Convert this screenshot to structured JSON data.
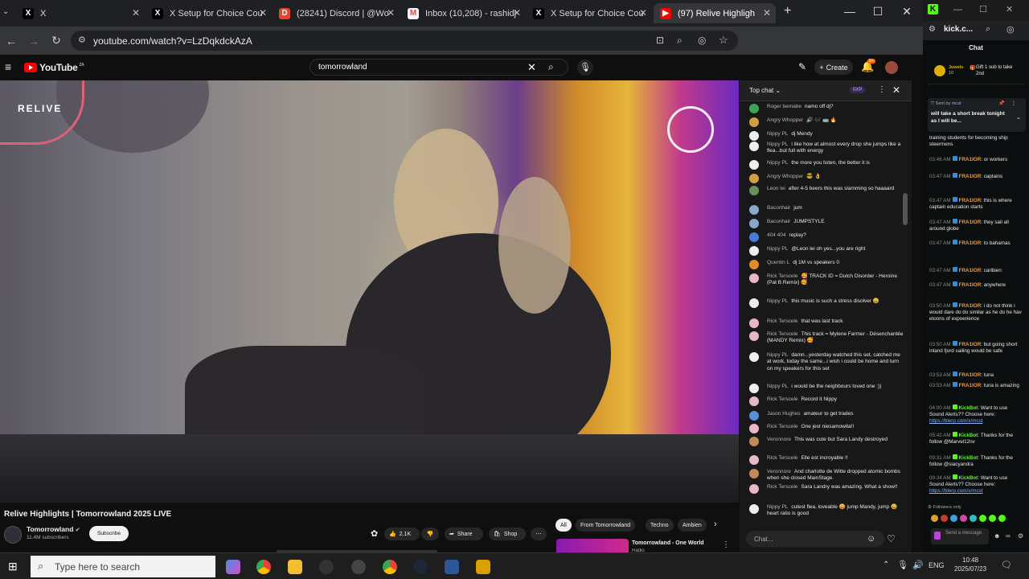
{
  "tabs": [
    {
      "title": "X",
      "icon": "X",
      "color": "#ffffff",
      "bg": "#000000"
    },
    {
      "title": "X Setup for Choice Cou",
      "icon": "X",
      "color": "#ffffff",
      "bg": "#000000"
    },
    {
      "title": "(28241) Discord | @Wo",
      "icon": "D",
      "color": "#ffffff",
      "bg": "#e8442b"
    },
    {
      "title": "Inbox (10,208) - rashidj",
      "icon": "M",
      "color": "#ea4335",
      "bg": "#ffffff"
    },
    {
      "title": "X Setup for Choice Cou",
      "icon": "X",
      "color": "#ffffff",
      "bg": "#000000"
    },
    {
      "title": "(97) Relive Highligh",
      "icon": "▶",
      "color": "#ffffff",
      "bg": "#ff0000"
    }
  ],
  "address": {
    "url": "youtube.com/watch?v=LzDqkdckAzA"
  },
  "youtube": {
    "logo": "YouTube",
    "country": "ZA",
    "search_value": "tomorrowland",
    "create_label": "Create",
    "notif_count": "9+"
  },
  "video": {
    "overlay_left": "RELIVE"
  },
  "info": {
    "title": "Relive Highlights | Tomorrowland 2025 LIVE",
    "channel": "Tomorrowland",
    "subscribers": "11.4M subscribers",
    "subscribe": "Subscribe",
    "likes": "2.1K",
    "share": "Share",
    "shop": "Shop"
  },
  "chips": [
    "All",
    "From Tomorrowland",
    "Techno",
    "Ambien"
  ],
  "related": {
    "title": "Tomorrowland - One World",
    "sub": "Radio"
  },
  "livechat": {
    "header": "Top chat",
    "xp": "0XP",
    "input_placeholder": "Chat...",
    "messages": [
      {
        "author": "Roger bemabe",
        "text": "namo off dj?",
        "color": "#3aa655"
      },
      {
        "author": "Angry Whopper",
        "text": "🔊 🎶 🚌 🔥",
        "color": "#d0a040"
      },
      {
        "author": "Nippy PL",
        "text": "dj Mendy",
        "color": "#eeeeee"
      },
      {
        "author": "Nippy PL",
        "text": "i like how at almost every drop she jumps like a flea...but full with energy",
        "color": "#eeeeee"
      },
      {
        "author": "Nippy PL",
        "text": "the more you listen, the better it is",
        "color": "#eeeeee"
      },
      {
        "author": "Angry Whopper",
        "text": "😎 👌",
        "color": "#d0a040"
      },
      {
        "author": "Leon lei",
        "text": "after 4-5 beers this was slamming so haaaard",
        "color": "#6b8f5a"
      },
      {
        "author": "Baconhair",
        "text": "jum",
        "color": "#8aa6c8"
      },
      {
        "author": "Baconhair",
        "text": "JUMPSTYLE",
        "color": "#8aa6c8"
      },
      {
        "author": "404 404",
        "text": "replay?",
        "color": "#4a7ad8"
      },
      {
        "author": "Nippy PL",
        "text": "@Leon lei oh yes...you are right",
        "color": "#eeeeee"
      },
      {
        "author": "Quentin L",
        "text": "dj 1M vs speakers 0",
        "color": "#e08a2a"
      },
      {
        "author": "Rick Terscele",
        "text": "🥰 TRACK ID = Dutch Disorder - Heroine (Pat B Remix) 🥰",
        "color": "#e8b8c8"
      },
      {
        "author": "Nippy PL",
        "text": "this music is such a stress disolver 😀",
        "color": "#eeeeee"
      },
      {
        "author": "Rick Terscele",
        "text": "that was last track",
        "color": "#e8b8c8"
      },
      {
        "author": "Rick Terscele",
        "text": "This track = Mylene Farmer - Désenchantée (MANDY Remix) 🥰",
        "color": "#e8b8c8"
      },
      {
        "author": "Nippy PL",
        "text": "damn...yesterday watched this set, catched me at work, today the same...i wish i could be home and turn on my speakers for this set",
        "color": "#eeeeee"
      },
      {
        "author": "Nippy PL",
        "text": "i would be the neighbours loved one :))",
        "color": "#eeeeee"
      },
      {
        "author": "Rick Terscele",
        "text": "Record it Nippy",
        "color": "#e8b8c8"
      },
      {
        "author": "Jason Hughes",
        "text": "amateur to get trades",
        "color": "#5a8fd8"
      },
      {
        "author": "Rick Terscele",
        "text": "One jest niesamowita!!",
        "color": "#e8b8c8"
      },
      {
        "author": "Veronnore",
        "text": "This was cute but Sara Landy destroyed",
        "color": "#c08a5a"
      },
      {
        "author": "Rick Terscele",
        "text": "Elle est incroyable !!",
        "color": "#e8b8c8"
      },
      {
        "author": "Veronnore",
        "text": "And charlotte de Witte dropped atomic bombs when she closed MainStage.",
        "color": "#c08a5a"
      },
      {
        "author": "Rick Terscele",
        "text": "Sara Landry was amazing. What a show!!",
        "color": "#e8b8c8"
      },
      {
        "author": "Nippy PL",
        "text": "cutest flea, loveable 😀 jump Mandy, jump 😀 heart ratio is good",
        "color": "#eeeeee"
      }
    ]
  },
  "kick": {
    "tab_label": "kick.c...",
    "chat_title": "Chat",
    "gift_user": "Juwels",
    "gift_count": "10",
    "gift_text": "Gift 1 sub to take 2nd",
    "pinned_by": "Sent by",
    "pinned_user": "mcst",
    "pinned_text": "will take a short break tonight as I will be...",
    "messages": [
      {
        "time": "",
        "user": "",
        "text": "training students for becoming ship steermens",
        "bot": false
      },
      {
        "time": "03:46 AM",
        "user": "FRA1IOR",
        "text": "or workers",
        "bot": false
      },
      {
        "time": "03:47 AM",
        "user": "FRA1IOR",
        "text": "captains",
        "bot": false
      },
      {
        "time": "03:47 AM",
        "user": "FRA1IOR",
        "text": "this is where captain education starts",
        "bot": false
      },
      {
        "time": "03:47 AM",
        "user": "FRA1IOR",
        "text": "they sail all around globe",
        "bot": false
      },
      {
        "time": "03:47 AM",
        "user": "FRA1IOR",
        "text": "to bahamas",
        "bot": false
      },
      {
        "time": "03:47 AM",
        "user": "FRA1IOR",
        "text": "caribien",
        "bot": false
      },
      {
        "time": "03:47 AM",
        "user": "FRA1IOR",
        "text": "anywhere",
        "bot": false
      },
      {
        "time": "03:50 AM",
        "user": "FRA1IOR",
        "text": "i do not think i would dare do do similar as he do he hav etonns of expoerience",
        "bot": false
      },
      {
        "time": "03:50 AM",
        "user": "FRA1IOR",
        "text": "but going short inland fjord sailing would be safe",
        "bot": false
      },
      {
        "time": "03:53 AM",
        "user": "FRA1IOR",
        "text": "tuna",
        "bot": false
      },
      {
        "time": "03:53 AM",
        "user": "FRA1IOR",
        "text": "tuna is amazing",
        "bot": false
      },
      {
        "time": "04:00 AM",
        "user": "KickBot",
        "text": "Want to use Sound Alerts?? Choose here:",
        "link": "https://blerp.com/x/mcst",
        "bot": true
      },
      {
        "time": "05:42 AM",
        "user": "KickBot",
        "text": "Thanks for the follow @Marvel12nv",
        "bot": true
      },
      {
        "time": "09:31 AM",
        "user": "KickBot",
        "text": "Thanks for the follow @siacyandra",
        "bot": true
      },
      {
        "time": "09:34 AM",
        "user": "KickBot",
        "text": "Want to use Sound Alerts?? Choose here:",
        "link": "https://blerp.com/x/mcst",
        "bot": true
      }
    ],
    "followers_only": "Followers only",
    "send_placeholder": "Send a message"
  },
  "taskbar": {
    "search_placeholder": "Type here to search",
    "lang": "ENG",
    "time": "10:48",
    "date": "2025/07/23"
  },
  "colors": {
    "yt_red": "#ff0000",
    "kick_green": "#53fc18",
    "chrome_bg": "#35363a"
  }
}
